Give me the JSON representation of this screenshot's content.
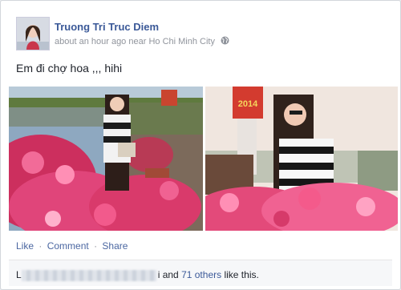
{
  "post": {
    "author": "Truong Tri Truc Diem",
    "time": "about an hour ago",
    "near_word": "near",
    "location": "Ho Chi Minh City",
    "message": "Em đi chợ hoa ,,, hihi",
    "photo2_sign_text": "2014"
  },
  "actions": {
    "like": "Like",
    "comment": "Comment",
    "share": "Share",
    "dot": "·"
  },
  "likes": {
    "prefix": "L",
    "name_tail": "i",
    "and": "and",
    "others_link": "71 others",
    "suffix": "like this."
  },
  "icons": {
    "privacy": "globe-icon"
  }
}
